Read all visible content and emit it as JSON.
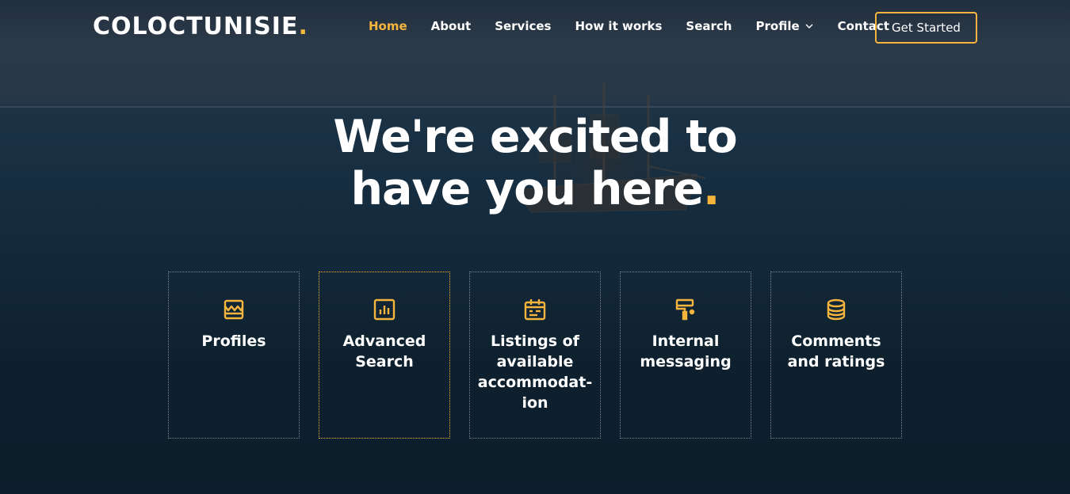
{
  "brand": {
    "name": "COLOCTUNISIE",
    "dot": "."
  },
  "nav": {
    "items": [
      {
        "label": "Home"
      },
      {
        "label": "About"
      },
      {
        "label": "Services"
      },
      {
        "label": "How it works"
      },
      {
        "label": "Search"
      },
      {
        "label": "Profile"
      },
      {
        "label": "Contact"
      }
    ],
    "cta_label": "Get Started"
  },
  "hero": {
    "line1": "We're excited to",
    "line2": "have you here",
    "dot": "."
  },
  "features": [
    {
      "title": "Profiles",
      "icon": "store-icon"
    },
    {
      "title": "Advanced Search",
      "icon": "bar-chart-icon"
    },
    {
      "title": "Listings of available accommodat-ion",
      "icon": "calendar-icon"
    },
    {
      "title": "Internal messaging",
      "icon": "paint-roller-icon"
    },
    {
      "title": "Comments and ratings",
      "icon": "database-icon"
    }
  ],
  "colors": {
    "accent": "#f5b53d",
    "text": "#ffffff"
  }
}
